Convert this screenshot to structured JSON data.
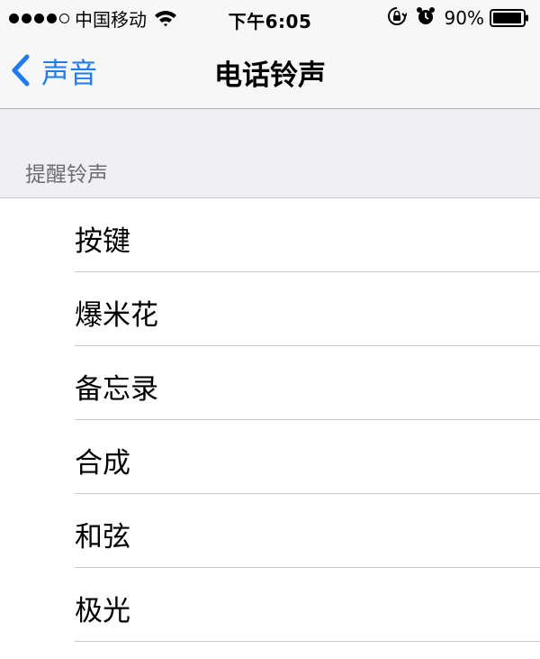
{
  "status_bar": {
    "carrier": "中国移动",
    "time": "下午6:05",
    "battery_percent": "90%",
    "icons": [
      "signal-icon",
      "wifi-icon",
      "rotation-lock-icon",
      "alarm-icon",
      "battery-icon"
    ]
  },
  "nav": {
    "back_label": "声音",
    "title": "电话铃声"
  },
  "section": {
    "header": "提醒铃声"
  },
  "ringtones": [
    {
      "label": "按键"
    },
    {
      "label": "爆米花"
    },
    {
      "label": "备忘录"
    },
    {
      "label": "合成"
    },
    {
      "label": "和弦"
    },
    {
      "label": "极光"
    }
  ],
  "colors": {
    "accent": "#1e7cf0",
    "bar_background": "#f7f7f7",
    "group_background": "#efeff4",
    "section_text": "#6d6d72",
    "separator": "#c8c7cc"
  }
}
